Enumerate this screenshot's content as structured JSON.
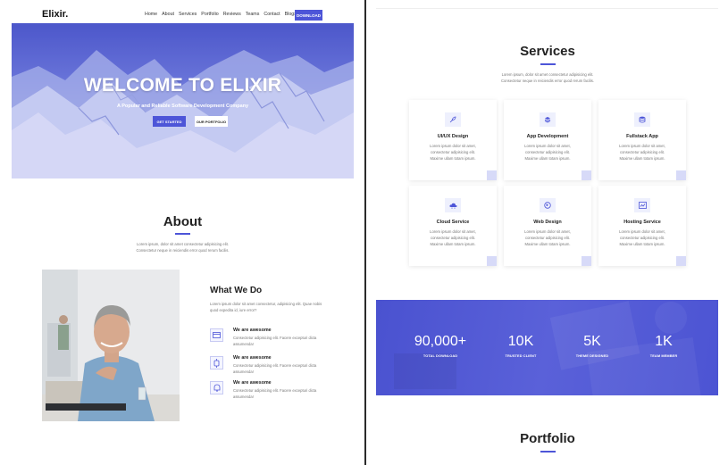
{
  "nav": {
    "logo": "Elixir.",
    "links": [
      "Home",
      "About",
      "Services",
      "Portfolio",
      "Reviews",
      "Teams",
      "Contact",
      "Blogs"
    ],
    "download": "DOWNLOAD"
  },
  "hero": {
    "title": "WELCOME TO ELIXIR",
    "subtitle": "A Popular and Reliable Software Development Company",
    "btn_primary": "GET STARTED",
    "btn_secondary": "OUR PORTFOLIO"
  },
  "about": {
    "title": "About",
    "desc_line1": "Lorem ipsum, dolor sit amet consectetur adipisicing elit.",
    "desc_line2": "Consectetur neque in reiciendis error quod rerum facilis.",
    "what_title": "What We Do",
    "what_desc": "Lorem ipsum dolor sit amet consectetur, adipisicing elit. Quae nobis quod expedita id, iure error?",
    "features": [
      {
        "title": "We are awesome",
        "desc": "Consectetur adipisicing elit. Facere excepturi dicta assumenda!",
        "icon": "card-icon"
      },
      {
        "title": "We are awesome",
        "desc": "Consectetur adipisicing elit. Facere excepturi dicta assumenda!",
        "icon": "watch-icon"
      },
      {
        "title": "We are awesome",
        "desc": "Consectetur adipisicing elit. Facere excepturi dicta assumenda!",
        "icon": "bell-icon"
      }
    ]
  },
  "services": {
    "title": "Services",
    "desc_line1": "Lorem ipsum, dolor sit amet consectetur adipisicing elit.",
    "desc_line2": "Consectetur neque in reiciendis error quod rerum facilis.",
    "card_desc": [
      "Lorem ipsum dolor sit amet,",
      "consectetur adipisicing elit.",
      "Maxime ullam totam ipsum."
    ],
    "items": [
      {
        "title": "UI/UX Design",
        "icon": "rocket-icon"
      },
      {
        "title": "App Development",
        "icon": "layers-icon"
      },
      {
        "title": "Fullstack App",
        "icon": "database-icon"
      },
      {
        "title": "Cloud Service",
        "icon": "cloud-icon"
      },
      {
        "title": "Web Design",
        "icon": "globe-icon"
      },
      {
        "title": "Hosting Service",
        "icon": "server-icon"
      }
    ]
  },
  "stats": [
    {
      "value": "90,000+",
      "label": "TOTAL DOWNLOAD"
    },
    {
      "value": "10K",
      "label": "TRUSTED CLIENT"
    },
    {
      "value": "5K",
      "label": "THEME DESIGNED"
    },
    {
      "value": "1K",
      "label": "TEAM MEMBER"
    }
  ],
  "portfolio": {
    "title": "Portfolio"
  },
  "colors": {
    "accent": "#4d55d8",
    "stats_bg": "#4a52d0"
  }
}
